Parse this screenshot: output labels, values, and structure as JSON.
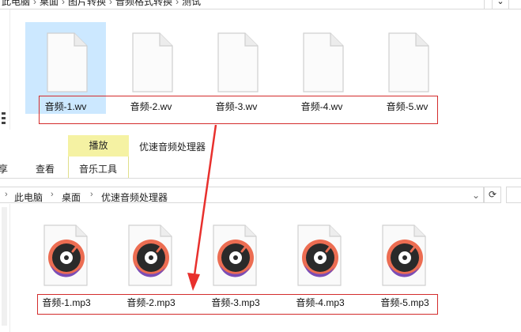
{
  "top_window": {
    "breadcrumb": [
      "此电脑",
      "桌面",
      "图片转换",
      "音频格式转换",
      "测试"
    ],
    "files": [
      {
        "name": "音频-1.wv",
        "selected": true
      },
      {
        "name": "音频-2.wv",
        "selected": false
      },
      {
        "name": "音频-3.wv",
        "selected": false
      },
      {
        "name": "音频-4.wv",
        "selected": false
      },
      {
        "name": "音频-5.wv",
        "selected": false
      }
    ]
  },
  "ribbon": {
    "contextual_tab": "播放",
    "window_title": "优速音频处理器",
    "tabs": [
      "共享",
      "查看"
    ],
    "tabs_display": [
      "享",
      "查看"
    ],
    "tool_tab": "音乐工具"
  },
  "bottom_window": {
    "breadcrumb": [
      "此电脑",
      "桌面",
      "优速音频处理器"
    ],
    "files": [
      {
        "name": "音频-1.mp3"
      },
      {
        "name": "音频-2.mp3"
      },
      {
        "name": "音频-3.mp3"
      },
      {
        "name": "音频-4.mp3"
      },
      {
        "name": "音频-5.mp3"
      }
    ]
  },
  "colors": {
    "highlight_box": "#d32c2c",
    "arrow": "#e8302d",
    "selection": "#cce8ff",
    "play_tab": "#f5f2a3"
  },
  "icons": {
    "wv_file": "blank-document-icon",
    "mp3_file": "music-disc-icon"
  }
}
